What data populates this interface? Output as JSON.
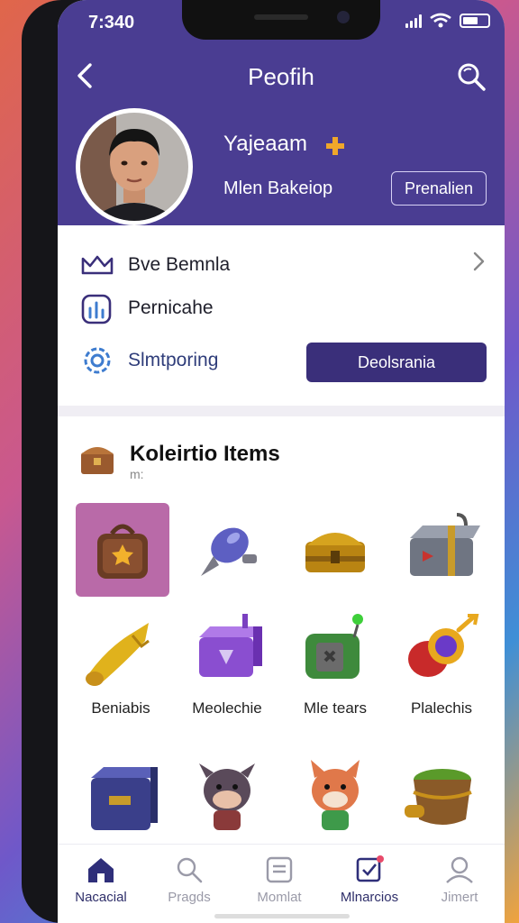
{
  "status_bar": {
    "time": "7:340"
  },
  "header": {
    "title": "Peofih",
    "username": "Yajeaam",
    "subtitle": "Mlen Bakeiop",
    "button_label": "Prenalien"
  },
  "menu": {
    "items": [
      {
        "label": "Bve Bemnla",
        "icon": "crown-icon"
      },
      {
        "label": "Pernicahe",
        "icon": "chart-icon"
      },
      {
        "label": "Slmtporing",
        "icon": "gear-icon"
      }
    ],
    "action_button": "Deolsrania"
  },
  "collection": {
    "title": "Koleirtio Items",
    "subtitle": "m:",
    "items": [
      {
        "label": "",
        "icon": "treasure-bag-icon",
        "selected": true
      },
      {
        "label": "",
        "icon": "rocket-icon"
      },
      {
        "label": "",
        "icon": "gold-chest-icon"
      },
      {
        "label": "",
        "icon": "metal-box-icon"
      },
      {
        "label": "Beniabis",
        "icon": "golden-horn-icon"
      },
      {
        "label": "Meolechie",
        "icon": "purple-device-icon"
      },
      {
        "label": "Mle tears",
        "icon": "green-machine-icon"
      },
      {
        "label": "Plalechis",
        "icon": "magic-orb-icon"
      },
      {
        "label": "",
        "icon": "blue-cube-icon"
      },
      {
        "label": "",
        "icon": "cow-figure-icon"
      },
      {
        "label": "",
        "icon": "fox-figure-icon"
      },
      {
        "label": "",
        "icon": "green-pot-icon"
      }
    ]
  },
  "tabs": [
    {
      "label": "Nacacial",
      "icon": "home-icon",
      "active": true
    },
    {
      "label": "Pragds",
      "icon": "search-icon"
    },
    {
      "label": "Momlat",
      "icon": "list-icon"
    },
    {
      "label": "Mlnarcios",
      "icon": "checkbox-icon",
      "active": true
    },
    {
      "label": "Jimert",
      "icon": "profile-icon"
    }
  ],
  "colors": {
    "header_bg": "#4a3d92",
    "primary_button": "#3a2f7a",
    "selected_item": "#b96aa8",
    "accent_icon": "#3e7ccf"
  }
}
